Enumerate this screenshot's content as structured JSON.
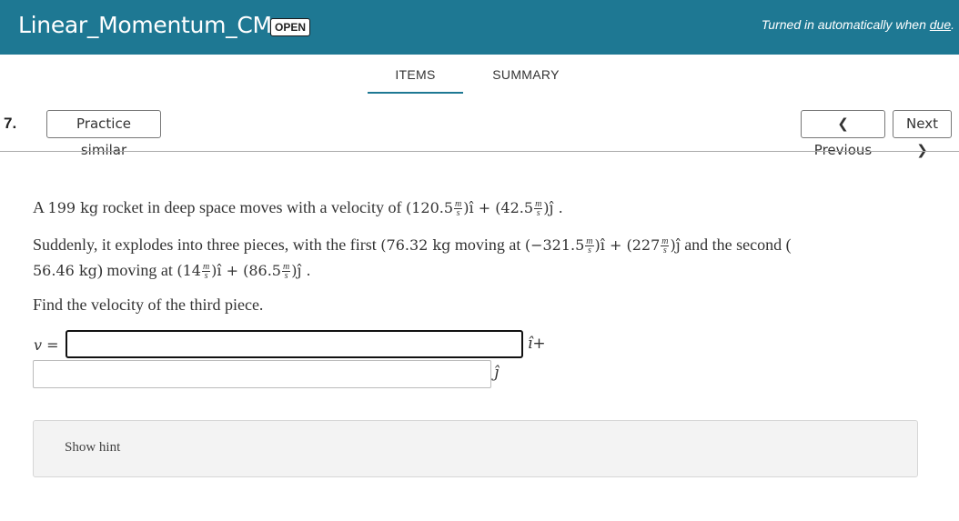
{
  "header": {
    "title": "Linear_Momentum_CM",
    "badge": "OPEN",
    "due_prefix": "Turned in automatically when ",
    "due_link": "due",
    "due_suffix": "."
  },
  "tabs": {
    "items": "ITEMS",
    "summary": "SUMMARY"
  },
  "question": {
    "number": "7.",
    "practice_label": "Practice similar",
    "prev_label": "Previous",
    "next_label": "Next"
  },
  "problem": {
    "l1_a": "A ",
    "l1_mass": "199 kg",
    "l1_b": " rocket in deep space moves with a velocity of ",
    "l1_vx": "(120.5",
    "l1_vy": ")ı̂ + (42.5",
    "l1_end": ")ȷ̂ .",
    "l2_a": "Suddenly, it explodes into three pieces, with the first ",
    "l2_m1": "(76.32 kg",
    "l2_b": " moving at ",
    "l2_v1x": "(−321.5",
    "l2_v1y": ")ı̂ + (227",
    "l2_v1e": ")ȷ̂",
    "l2_c": " and the second (",
    "l3_m2": "56.46 kg",
    "l3_a": ") moving at ",
    "l3_v2x": "(14",
    "l3_v2y": ")ı̂ + (86.5",
    "l3_v2e": ")ȷ̂ .",
    "l4": "Find the velocity of the third piece.",
    "unit_num": "m",
    "unit_den": "s"
  },
  "answer": {
    "v_label": "v =",
    "i_suffix": "ı̂+",
    "j_suffix": "ȷ̂",
    "i_value": "",
    "j_value": ""
  },
  "hint": {
    "label": "Show hint"
  },
  "colors": {
    "header_bg": "#1e7893",
    "tab_underline": "#1e7893",
    "hint_bg": "#f3f3f3"
  }
}
